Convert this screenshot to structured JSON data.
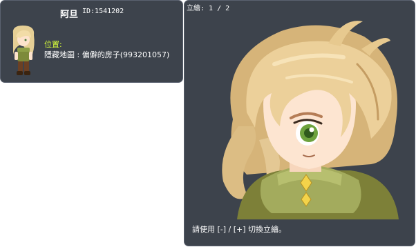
{
  "npc": {
    "name": "阿旦",
    "id_text": "ID:1541202",
    "location_label": "位置:",
    "location_value": "隱藏地圖 : 偏僻的房子(993201057)"
  },
  "portrait": {
    "counter": "立繪: 1 / 2",
    "hint": "請使用 [-] / [+] 切換立繪。"
  },
  "colors": {
    "panel_bg": "#3d434c",
    "panel_border": "#5b6270",
    "location_label": "#d9ff3a",
    "text": "#ffffff"
  }
}
